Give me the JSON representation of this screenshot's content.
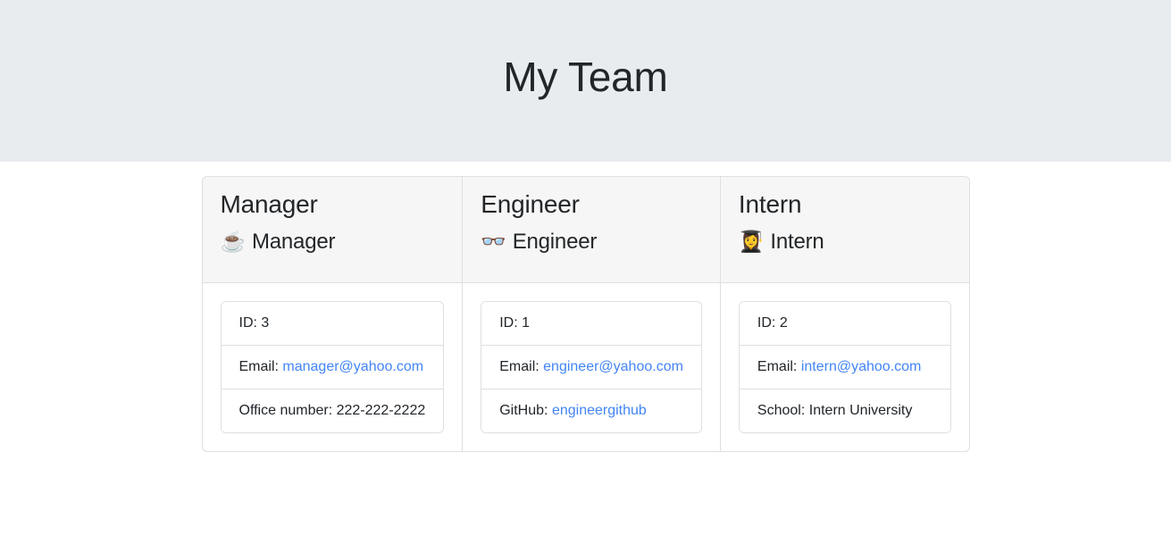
{
  "header": {
    "title": "My Team"
  },
  "colors": {
    "header_background": "#e9ecef",
    "card_header_background": "#f6f6f6",
    "border": "#dfdfdf",
    "link": "#4285f4",
    "text": "#212529"
  },
  "cards": [
    {
      "title": "Manager",
      "role_label": "Manager",
      "role_icon": "coffee-cup-icon",
      "role_emoji": "☕",
      "items": [
        {
          "label": "ID:",
          "value": "3",
          "is_link": false
        },
        {
          "label": "Email:",
          "value": "manager@yahoo.com",
          "is_link": true
        },
        {
          "label": "Office number:",
          "value": "222-222-2222",
          "is_link": false
        }
      ]
    },
    {
      "title": "Engineer",
      "role_label": "Engineer",
      "role_icon": "glasses-icon",
      "role_emoji": "👓",
      "items": [
        {
          "label": "ID:",
          "value": "1",
          "is_link": false
        },
        {
          "label": "Email:",
          "value": "engineer@yahoo.com",
          "is_link": true
        },
        {
          "label": "GitHub:",
          "value": "engineergithub",
          "is_link": true
        }
      ]
    },
    {
      "title": "Intern",
      "role_label": "Intern",
      "role_icon": "graduate-icon",
      "role_emoji": "👩‍🎓",
      "items": [
        {
          "label": "ID:",
          "value": "2",
          "is_link": false
        },
        {
          "label": "Email:",
          "value": "intern@yahoo.com",
          "is_link": true
        },
        {
          "label": "School:",
          "value": "Intern University",
          "is_link": false
        }
      ]
    }
  ]
}
